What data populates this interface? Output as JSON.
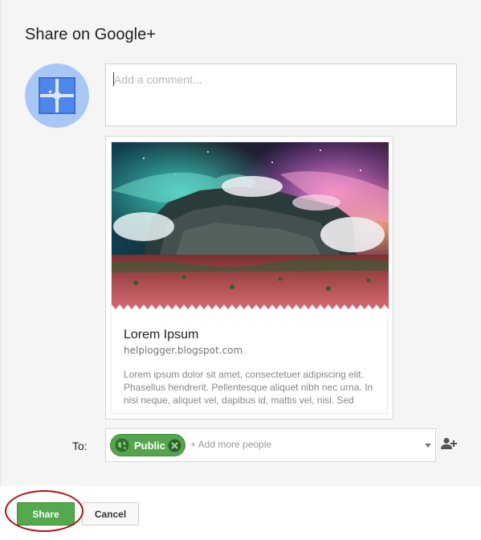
{
  "dialog": {
    "title": "Share on Google+"
  },
  "composer": {
    "avatar_icon": "blogger-puzzle-icon",
    "comment_placeholder": "Add a comment..."
  },
  "preview": {
    "title": "Lorem Ipsum",
    "domain": "helplogger.blogspot.com",
    "description": "Lorem ipsum dolor sit amet, consectetuer adipiscing elit. Phasellus hendrerit. Pellentesque aliquet nibh nec urna. In nisi neque, aliquet vel, dapibus id, mattis vel, nisi. Sed"
  },
  "audience": {
    "to_label": "To:",
    "chip_label": "Public",
    "chip_icon": "globe-icon",
    "add_placeholder": "+ Add more people",
    "add_person_icon": "add-person-icon",
    "colors": {
      "chip": "#55a54f"
    }
  },
  "footer": {
    "share_label": "Share",
    "cancel_label": "Cancel",
    "colors": {
      "share": "#53a94d",
      "highlight": "#b0131a"
    }
  }
}
